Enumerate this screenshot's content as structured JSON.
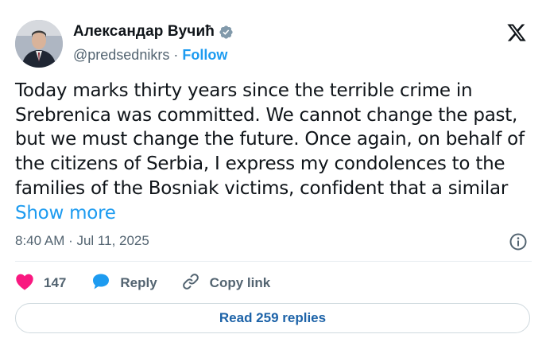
{
  "author": {
    "display_name": "Александар Вучић",
    "handle": "@predsednikrs",
    "separator": "·",
    "follow_label": "Follow",
    "verified_color": "#829aab"
  },
  "tweet": {
    "text": "Today marks thirty years since the terrible crime in Srebrenica was committed. We cannot change the past, but we must change the future. Once again, on behalf of the citizens of Serbia, I express my condolences to the families of the Bosniak victims, confident that a similar",
    "show_more_label": "Show more",
    "timestamp": "8:40 AM · Jul 11, 2025"
  },
  "actions": {
    "like_count": "147",
    "reply_label": "Reply",
    "copy_link_label": "Copy link"
  },
  "read_replies_label": "Read 259 replies",
  "colors": {
    "accent": "#1d9bf0",
    "like": "#f91880",
    "muted": "#536471"
  },
  "icons": [
    "verified-badge-icon",
    "x-logo-icon",
    "info-icon",
    "heart-icon",
    "reply-bubble-icon",
    "link-icon"
  ]
}
